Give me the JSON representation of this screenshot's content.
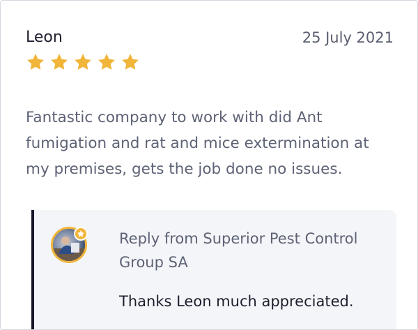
{
  "review": {
    "reviewer_name": "Leon",
    "date": "25 July 2021",
    "rating": 5,
    "rating_max": 5,
    "star_color": "#f1b53a",
    "body": "Fantastic company to work with did Ant fumigation and rat and mice extermination at my premises, gets the job done no issues."
  },
  "reply": {
    "title": "Reply from Superior Pest Control Group SA",
    "text": "Thanks Leon much appreciated.",
    "avatar_icon": "company-avatar",
    "badge_icon": "verified-star-icon",
    "accent_color": "#16162a"
  }
}
